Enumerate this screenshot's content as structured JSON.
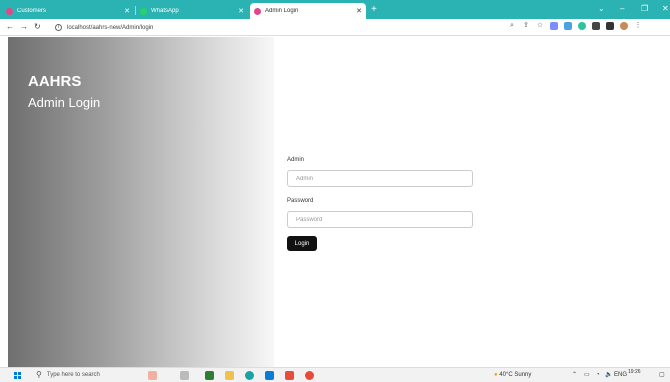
{
  "browser": {
    "tabs": [
      {
        "label": "Customers",
        "favicon_color": "#e0488a"
      },
      {
        "label": "WhatsApp",
        "favicon_color": "#25d366"
      },
      {
        "label": "Admin Login",
        "favicon_color": "#e0488a"
      }
    ],
    "new_tab": "+",
    "url": "localhost/aahrs-new/Admin/login",
    "accent_color": "#2bb3b3"
  },
  "page": {
    "brand": "AAHRS",
    "subtitle": "Admin Login",
    "form": {
      "admin_label": "Admin",
      "admin_placeholder": "Admin",
      "password_label": "Password",
      "password_placeholder": "Password",
      "login_button": "Login"
    }
  },
  "taskbar": {
    "search_placeholder": "Type here to search",
    "weather": "40°C  Sunny",
    "language": "ENG",
    "time": "19:26"
  }
}
